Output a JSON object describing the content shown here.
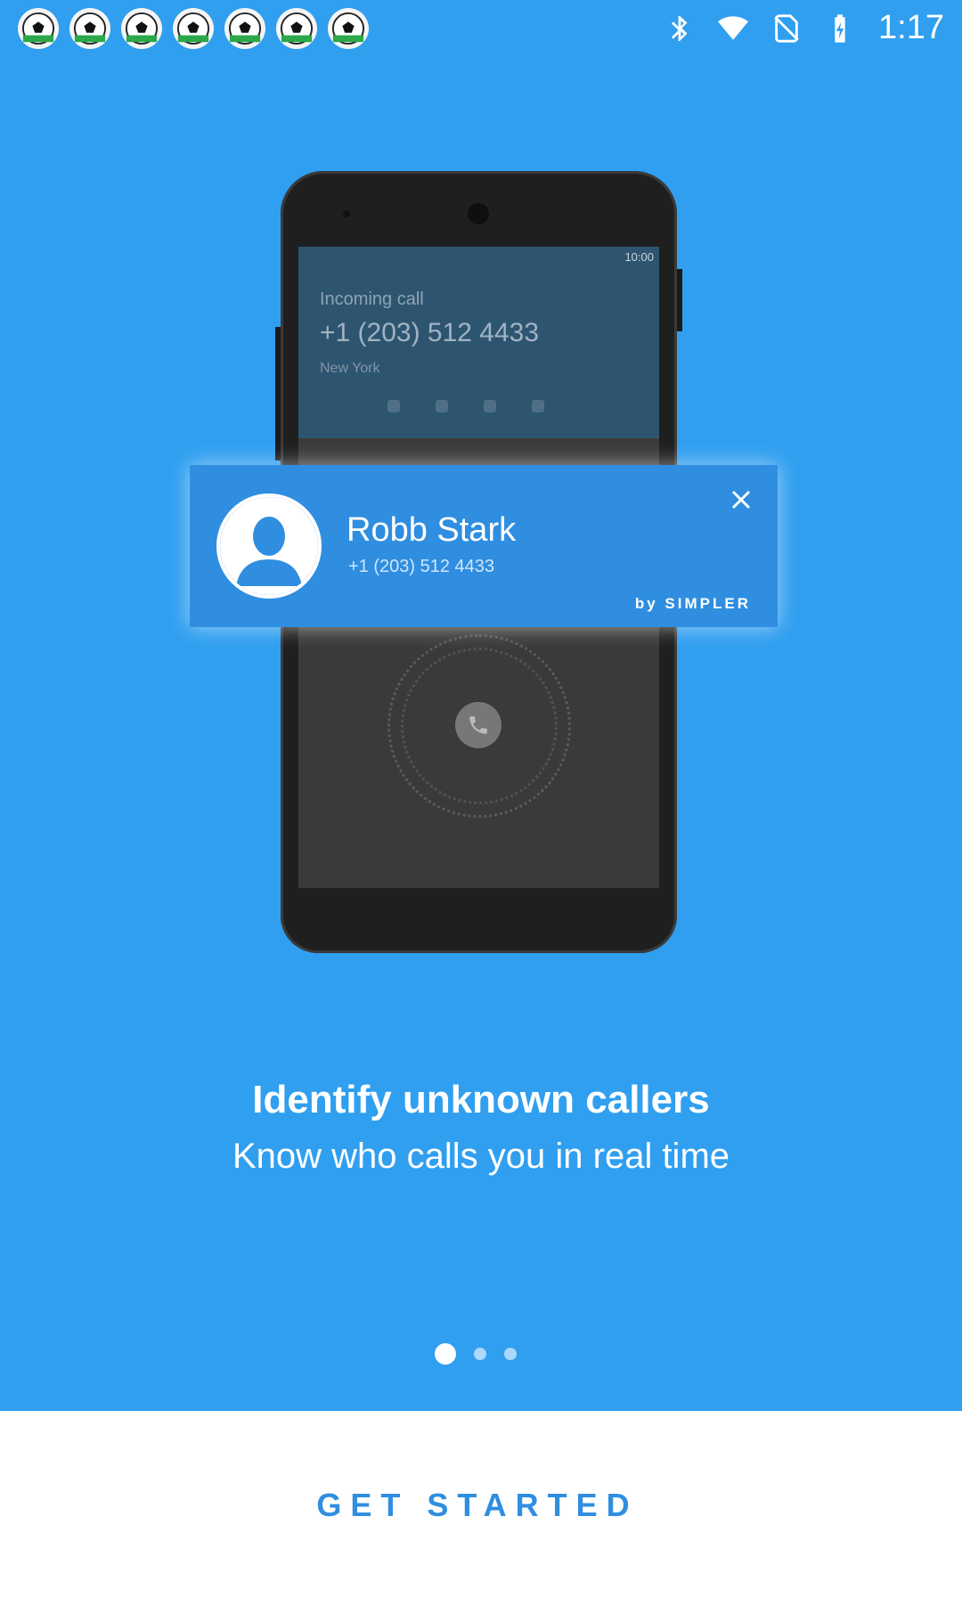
{
  "status_bar": {
    "time": "1:17",
    "icons": [
      "soccer-ball-icon",
      "soccer-ball-icon",
      "soccer-ball-icon",
      "soccer-ball-icon",
      "soccer-ball-icon",
      "soccer-ball-icon",
      "soccer-ball-icon"
    ],
    "right_icons": [
      "bluetooth-icon",
      "wifi-icon",
      "no-sim-icon",
      "battery-charging-icon"
    ]
  },
  "hero": {
    "screen": {
      "mini_status": "10:00",
      "incoming_title": "Incoming call",
      "incoming_number": "+1 (203) 512 4433",
      "incoming_city": "New York"
    },
    "card": {
      "name": "Robb Stark",
      "number": "+1 (203) 512 4433",
      "brand": "by SIMPLER"
    }
  },
  "onboarding": {
    "title": "Identify unknown callers",
    "subtitle": "Know who calls you in real time"
  },
  "pager": {
    "current_page": 1,
    "total_pages": 3
  },
  "cta": {
    "label": "GET STARTED"
  },
  "colors": {
    "background": "#309ff0",
    "accent": "#2f8ee0"
  }
}
